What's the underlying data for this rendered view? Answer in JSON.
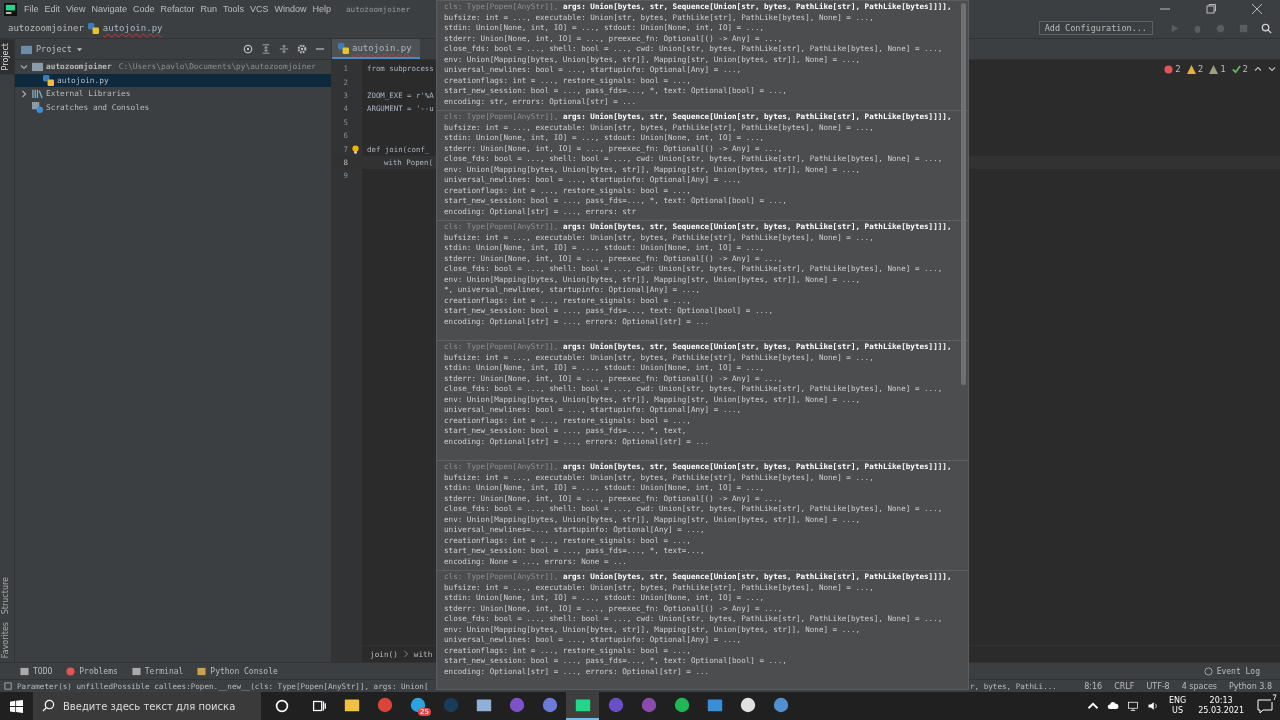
{
  "menu": [
    "File",
    "Edit",
    "View",
    "Navigate",
    "Code",
    "Refactor",
    "Run",
    "Tools",
    "VCS",
    "Window",
    "Help"
  ],
  "window": {
    "title": "autozoomjoiner"
  },
  "breadcrumb": [
    "autozoomjoiner",
    "autojoin.py"
  ],
  "toolbar": {
    "run_config": "Add Configuration..."
  },
  "side_tabs": [
    {
      "label": "Project",
      "selected": true
    },
    {
      "label": "Structure",
      "selected": false
    },
    {
      "label": "Favorites",
      "selected": false
    }
  ],
  "project": {
    "title": "Project",
    "tree": [
      {
        "label": "autozoomjoiner",
        "path": "C:\\Users\\pavlo\\Documents\\py\\autozoomjoiner",
        "kind": "folder",
        "expanded": true,
        "selected": false,
        "children": [
          {
            "label": "autojoin.py",
            "kind": "python",
            "selected": true
          }
        ]
      },
      {
        "label": "External Libraries",
        "kind": "libraries",
        "expanded": false,
        "selected": false
      },
      {
        "label": "Scratches and Consoles",
        "kind": "scratches",
        "selected": false
      }
    ]
  },
  "editor": {
    "tab": "autojoin.py",
    "lines": [
      {
        "num": "1",
        "code": "from subprocess",
        "current": false
      },
      {
        "num": "2",
        "current": false
      },
      {
        "num": "3",
        "code": "ZOOM_EXE = r'%A",
        "current": false
      },
      {
        "num": "4",
        "code": "ARGUMENT = '--u",
        "current": false
      },
      {
        "num": "5",
        "current": false
      },
      {
        "num": "6",
        "current": false
      },
      {
        "num": "7",
        "code": "def join(conf_",
        "current": false
      },
      {
        "num": "8",
        "code": "with Popen(",
        "current": true
      },
      {
        "num": "9",
        "current": false
      }
    ],
    "inspections": [
      {
        "kind": "error",
        "count": "2"
      },
      {
        "kind": "warning",
        "count": "2"
      },
      {
        "kind": "weak",
        "count": "1"
      },
      {
        "kind": "ok",
        "count": "2"
      }
    ],
    "breadcrumbs": [
      "join()",
      "with"
    ]
  },
  "popup": {
    "blocks": [
      {
        "dim": "cls: Type[Popen[AnyStr]],",
        "head": "args: Union[bytes, str, Sequence[Union[str, bytes, PathLike[str], PathLike[bytes]]]],",
        "lines": [
          "bufsize: int = ..., executable: Union[str, bytes, PathLike[str], PathLike[bytes], None] = ...,",
          "stdin: Union[None, int, IO] = ..., stdout: Union[None, int, IO] = ...,",
          "stderr: Union[None, int, IO] = ..., preexec_fn: Optional[() -> Any] = ...,",
          "close_fds: bool = ..., shell: bool = ..., cwd: Union[str, bytes, PathLike[str], PathLike[bytes], None] = ...,",
          "env: Union[Mapping[bytes, Union[bytes, str]], Mapping[str, Union[bytes, str]], None] = ...,",
          "universal_newlines: bool = ..., startupinfo: Optional[Any] = ...,",
          "creationflags: int = ..., restore_signals: bool = ...,",
          "start_new_session: bool = ..., pass_fds=..., *, text: Optional[bool] = ...,",
          "encoding: str, errors: Optional[str] = ..."
        ]
      },
      {
        "dim": "cls: Type[Popen[AnyStr]],",
        "head": "args: Union[bytes, str, Sequence[Union[str, bytes, PathLike[str], PathLike[bytes]]]],",
        "lines": [
          "bufsize: int = ..., executable: Union[str, bytes, PathLike[str], PathLike[bytes], None] = ...,",
          "stdin: Union[None, int, IO] = ..., stdout: Union[None, int, IO] = ...,",
          "stderr: Union[None, int, IO] = ..., preexec_fn: Optional[() -> Any] = ...,",
          "close_fds: bool = ..., shell: bool = ..., cwd: Union[str, bytes, PathLike[str], PathLike[bytes], None] = ...,",
          "env: Union[Mapping[bytes, Union[bytes, str]], Mapping[str, Union[bytes, str]], None] = ...,",
          "universal_newlines: bool = ..., startupinfo: Optional[Any] = ...,",
          "creationflags: int = ..., restore_signals: bool = ...,",
          "start_new_session: bool = ..., pass_fds=..., *, text: Optional[bool] = ...,",
          "encoding: Optional[str] = ..., errors: str"
        ]
      },
      {
        "dim": "cls: Type[Popen[AnyStr]],",
        "head": "args: Union[bytes, str, Sequence[Union[str, bytes, PathLike[str], PathLike[bytes]]]],",
        "lines": [
          "bufsize: int = ..., executable: Union[str, bytes, PathLike[str], PathLike[bytes], None] = ...,",
          "stdin: Union[None, int, IO] = ..., stdout: Union[None, int, IO] = ...,",
          "stderr: Union[None, int, IO] = ..., preexec_fn: Optional[() -> Any] = ...,",
          "close_fds: bool = ..., shell: bool = ..., cwd: Union[str, bytes, PathLike[str], PathLike[bytes], None] = ...,",
          "env: Union[Mapping[bytes, Union[bytes, str]], Mapping[str, Union[bytes, str]], None] = ...,",
          "*, universal_newlines, startupinfo: Optional[Any] = ...,",
          "creationflags: int = ..., restore_signals: bool = ...,",
          "start_new_session: bool = ..., pass_fds=..., text: Optional[bool] = ...,",
          "encoding: Optional[str] = ..., errors: Optional[str] = ..."
        ]
      },
      {
        "dim": "cls: Type[Popen[AnyStr]],",
        "head": "args: Union[bytes, str, Sequence[Union[str, bytes, PathLike[str], PathLike[bytes]]]],",
        "lines": [
          "bufsize: int = ..., executable: Union[str, bytes, PathLike[str], PathLike[bytes], None] = ...,",
          "stdin: Union[None, int, IO] = ..., stdout: Union[None, int, IO] = ...,",
          "stderr: Union[None, int, IO] = ..., preexec_fn: Optional[() -> Any] = ...,",
          "close_fds: bool = ..., shell: bool = ..., cwd: Union[str, bytes, PathLike[str], PathLike[bytes], None] = ...,",
          "env: Union[Mapping[bytes, Union[bytes, str]], Mapping[str, Union[bytes, str]], None] = ...,",
          "universal_newlines: bool = ..., startupinfo: Optional[Any] = ...,",
          "creationflags: int = ..., restore_signals: bool = ...,",
          "start_new_session: bool = ..., pass_fds=..., *, text,",
          "encoding: Optional[str] = ..., errors: Optional[str] = ..."
        ]
      },
      {
        "dim": "cls: Type[Popen[AnyStr]],",
        "head": "args: Union[bytes, str, Sequence[Union[str, bytes, PathLike[str], PathLike[bytes]]]],",
        "lines": [
          "bufsize: int = ..., executable: Union[str, bytes, PathLike[str], PathLike[bytes], None] = ...,",
          "stdin: Union[None, int, IO] = ..., stdout: Union[None, int, IO] = ...,",
          "stderr: Union[None, int, IO] = ..., preexec_fn: Optional[() -> Any] = ...,",
          "close_fds: bool = ..., shell: bool = ..., cwd: Union[str, bytes, PathLike[str], PathLike[bytes], None] = ...,",
          "env: Union[Mapping[bytes, Union[bytes, str]], Mapping[str, Union[bytes, str]], None] = ...,",
          "universal_newlines=..., startupinfo: Optional[Any] = ...,",
          "creationflags: int = ..., restore_signals: bool = ...,",
          "start_new_session: bool = ..., pass_fds=..., *, text=...,",
          "encoding: None = ..., errors: None = ..."
        ]
      },
      {
        "dim": "cls: Type[Popen[AnyStr]],",
        "head": "args: Union[bytes, str, Sequence[Union[str, bytes, PathLike[str], PathLike[bytes]]]],",
        "lines": [
          "bufsize: int = ..., executable: Union[str, bytes, PathLike[str], PathLike[bytes], None] = ...,",
          "stdin: Union[None, int, IO] = ..., stdout: Union[None, int, IO] = ...,",
          "stderr: Union[None, int, IO] = ..., preexec_fn: Optional[() -> Any] = ...,",
          "close_fds: bool = ..., shell: bool = ..., cwd: Union[str, bytes, PathLike[str], PathLike[bytes], None] = ...,",
          "env: Union[Mapping[bytes, Union[bytes, str]], Mapping[str, Union[bytes, str]], None] = ...,",
          "universal_newlines: bool = ..., startupinfo: Optional[Any] = ...,",
          "creationflags: int = ..., restore_signals: bool = ...,",
          "start_new_session: bool = ..., pass_fds=..., *, text: Optional[bool] = ...,",
          "encoding: Optional[str] = ..., errors: Optional[str] = ..."
        ]
      }
    ]
  },
  "tool_tabs": [
    {
      "label": "TODO",
      "kind": "todo"
    },
    {
      "label": "Problems",
      "kind": "problems"
    },
    {
      "label": "Terminal",
      "kind": "terminal"
    },
    {
      "label": "Python Console",
      "kind": "python"
    }
  ],
  "event_log": "Event Log",
  "status_bar": {
    "message": "Parameter(s) unfilledPossible callees:Popen.__new__(cls: Type[Popen[AnyStr]], args: Union[",
    "message_tail": "r, bytes, PathLi...",
    "items": [
      "8:16",
      "CRLF",
      "UTF-8",
      "4 spaces",
      "Python 3.8"
    ]
  },
  "taskbar": {
    "search_placeholder": "Введите здесь текст для поиска",
    "apps": [
      {
        "kind": "explorer",
        "selected": false
      },
      {
        "kind": "chrome",
        "selected": false
      },
      {
        "kind": "telegram",
        "badge": "25",
        "selected": false
      },
      {
        "kind": "steam",
        "selected": false
      },
      {
        "kind": "monitor",
        "selected": false
      },
      {
        "kind": "viber",
        "selected": false
      },
      {
        "kind": "chat",
        "selected": false
      },
      {
        "kind": "pycharm",
        "selected": true
      },
      {
        "kind": "galaxy",
        "selected": false
      },
      {
        "kind": "github",
        "selected": false
      },
      {
        "kind": "spotify",
        "selected": false
      },
      {
        "kind": "remote",
        "selected": false
      },
      {
        "kind": "settings",
        "selected": false
      },
      {
        "kind": "network",
        "selected": false
      }
    ],
    "lang": [
      "ENG",
      "US"
    ],
    "time": "20:13",
    "date": "25.03.2021",
    "notifications": "7"
  }
}
